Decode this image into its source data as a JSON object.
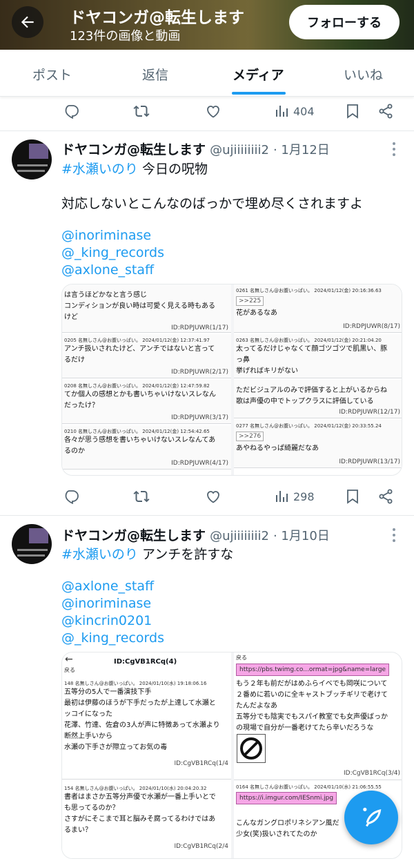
{
  "header": {
    "title": "ドヤコンガ@転生します",
    "subtitle": "123件の画像と動画",
    "follow_label": "フォローする"
  },
  "tabs": [
    {
      "label": "ポスト"
    },
    {
      "label": "返信"
    },
    {
      "label": "メディア",
      "active": true
    },
    {
      "label": "いいね"
    }
  ],
  "top_actions": {
    "views": "404"
  },
  "tweets": [
    {
      "name": "ドヤコンガ@転生します",
      "handle": "@ujiiiiiiii2",
      "date": "· 1月12日",
      "hashtag": "#水瀬いのり",
      "hashtag_rest": " 今日の呪物",
      "line2": "対応しないとこんなのばっかで埋め尽くされますよ",
      "mentions": [
        "@inoriminase",
        "@_king_records",
        "@axlone_staff"
      ],
      "views": "298",
      "media": {
        "left_posts": [
          {
            "lines": [
              "は言うほどかなと言う感じ",
              "コンディションが良い時は可愛く見える時もある",
              "けど"
            ],
            "id": "ID:RDPJUWR(1/17)"
          },
          {
            "header": "0205 名無しさん@お腹いっぱい。 2024/01/12(金) 12:37:41.97",
            "lines": [
              "アンチ扱いされたけど、アンチではないと言って",
              "るだけ"
            ],
            "id": "ID:RDPJUWR(2/17)"
          },
          {
            "header": "0208 名無しさん@お腹いっぱい。 2024/01/12(金) 12:47:59.82",
            "lines": [
              "てか個人の感想とかも書いちゃいけないスレなん",
              "だったけ？"
            ],
            "id": "ID:RDPJUWR(3/17)"
          },
          {
            "header": "0210 名無しさん@お腹いっぱい。 2024/01/12(金) 12:54:42.65",
            "lines": [
              "各々が思う感想を書いちゃいけないスレなんてあ",
              "るのか"
            ],
            "id": "ID:RDPJUWR(4/17)"
          }
        ],
        "right_posts": [
          {
            "header": "0261 名無しさん@お腹いっぱい。 2024/01/12(金) 20:16:36.63",
            "reply": ">>225",
            "lines": [
              "花があるなあ"
            ],
            "id": "ID:RDPJUWR(8/17)"
          },
          {
            "header": "0263 名無しさん@お腹いっぱい。 2024/01/12(金) 20:21:04.20",
            "lines": [
              "太ってるだけじゃなくて顔ゴツゴツで肌黒い、豚",
              "っ鼻",
              "挙げればキリがない"
            ]
          },
          {
            "lines": [
              "ただビジュアルのみで評価すると上がいるからね",
              "歌は声優の中でトップクラスに評価している"
            ],
            "id": "ID:RDPJUWR(12/17)"
          },
          {
            "header": "0277 名無しさん@お腹いっぱい。 2024/01/12(金) 20:33:55.24",
            "reply": ">>276",
            "lines": [
              "あやねるやっぱ綺麗だなあ"
            ],
            "id": "ID:RDPJUWR(13/17)"
          }
        ]
      }
    },
    {
      "name": "ドヤコンガ@転生します",
      "handle": "@ujiiiiiiii2",
      "date": "· 1月10日",
      "hashtag": "#水瀬いのり",
      "hashtag_rest": " アンチを許すな",
      "mentions": [
        "@axlone_staff",
        "@inoriminase",
        "@kincrin0201",
        "@_king_records"
      ],
      "media": {
        "left_title": "ID:CgVB1RCq(4)",
        "left_back": "戻る",
        "left_post1_header": "148 名無しさん@お腹いっぱい。 2024/01/10(水) 19:18:06.16",
        "left_post1_lines": [
          "五等分の5人で一番演技下手",
          "最初は伊藤のほうが下手だったが上達して水瀬と",
          "ッコイになった",
          "花澤、竹達、佐倉の3人が声に特徴あって水瀬より",
          "断然上手いから",
          "水瀬の下手さが際立ってお気の毒"
        ],
        "left_post1_id": "ID:CgVB1RCq(1/4",
        "left_post2_header": "154 名無しさん@お腹いっぱい。 2024/01/10(水) 20:04:20.32",
        "left_post2_lines": [
          "書者はまさか五等分声優で水瀬が一番上手いとで",
          "も思ってるのか？",
          "さすがにそこまで耳と脳みそ腐ってるわけではあ",
          "るまい？"
        ],
        "left_post2_id": "ID:CgVB1RCq(2/4",
        "right_back": "戻る",
        "right_link1": "https://pbs.twimg.co...ormat=jpg&name=large",
        "right_lines": [
          "もう２年も前だがはめふらイベでも岡咲について",
          "２番めに若いのに全キャストブッチギリで老けて",
          "たんだよなあ",
          "五等分でも陰実でもスパイ教室でも女声優ばっか",
          "の現場で自分が一番老けてたら辛いだろうな"
        ],
        "right_id": "ID:CgVB1RCq(3/4)",
        "right_post2_header": "0164 名無しさん@お腹いっぱい。 2024/01/10(水) 21:06:55.55",
        "right_link2": "https://i.imgur.com/IESnmi.jpg",
        "right_lines2": [
          "こんなガングロポリネシアン風だ",
          "少女(笑)扱いされてたのか"
        ]
      }
    }
  ],
  "icons": [
    "back-arrow-icon",
    "reply-icon",
    "retweet-icon",
    "like-icon",
    "views-icon",
    "bookmark-icon",
    "share-icon",
    "more-icon",
    "compose-icon"
  ],
  "colors": {
    "accent": "#1d9bf0",
    "text": "#0f1419",
    "muted": "#536471"
  }
}
